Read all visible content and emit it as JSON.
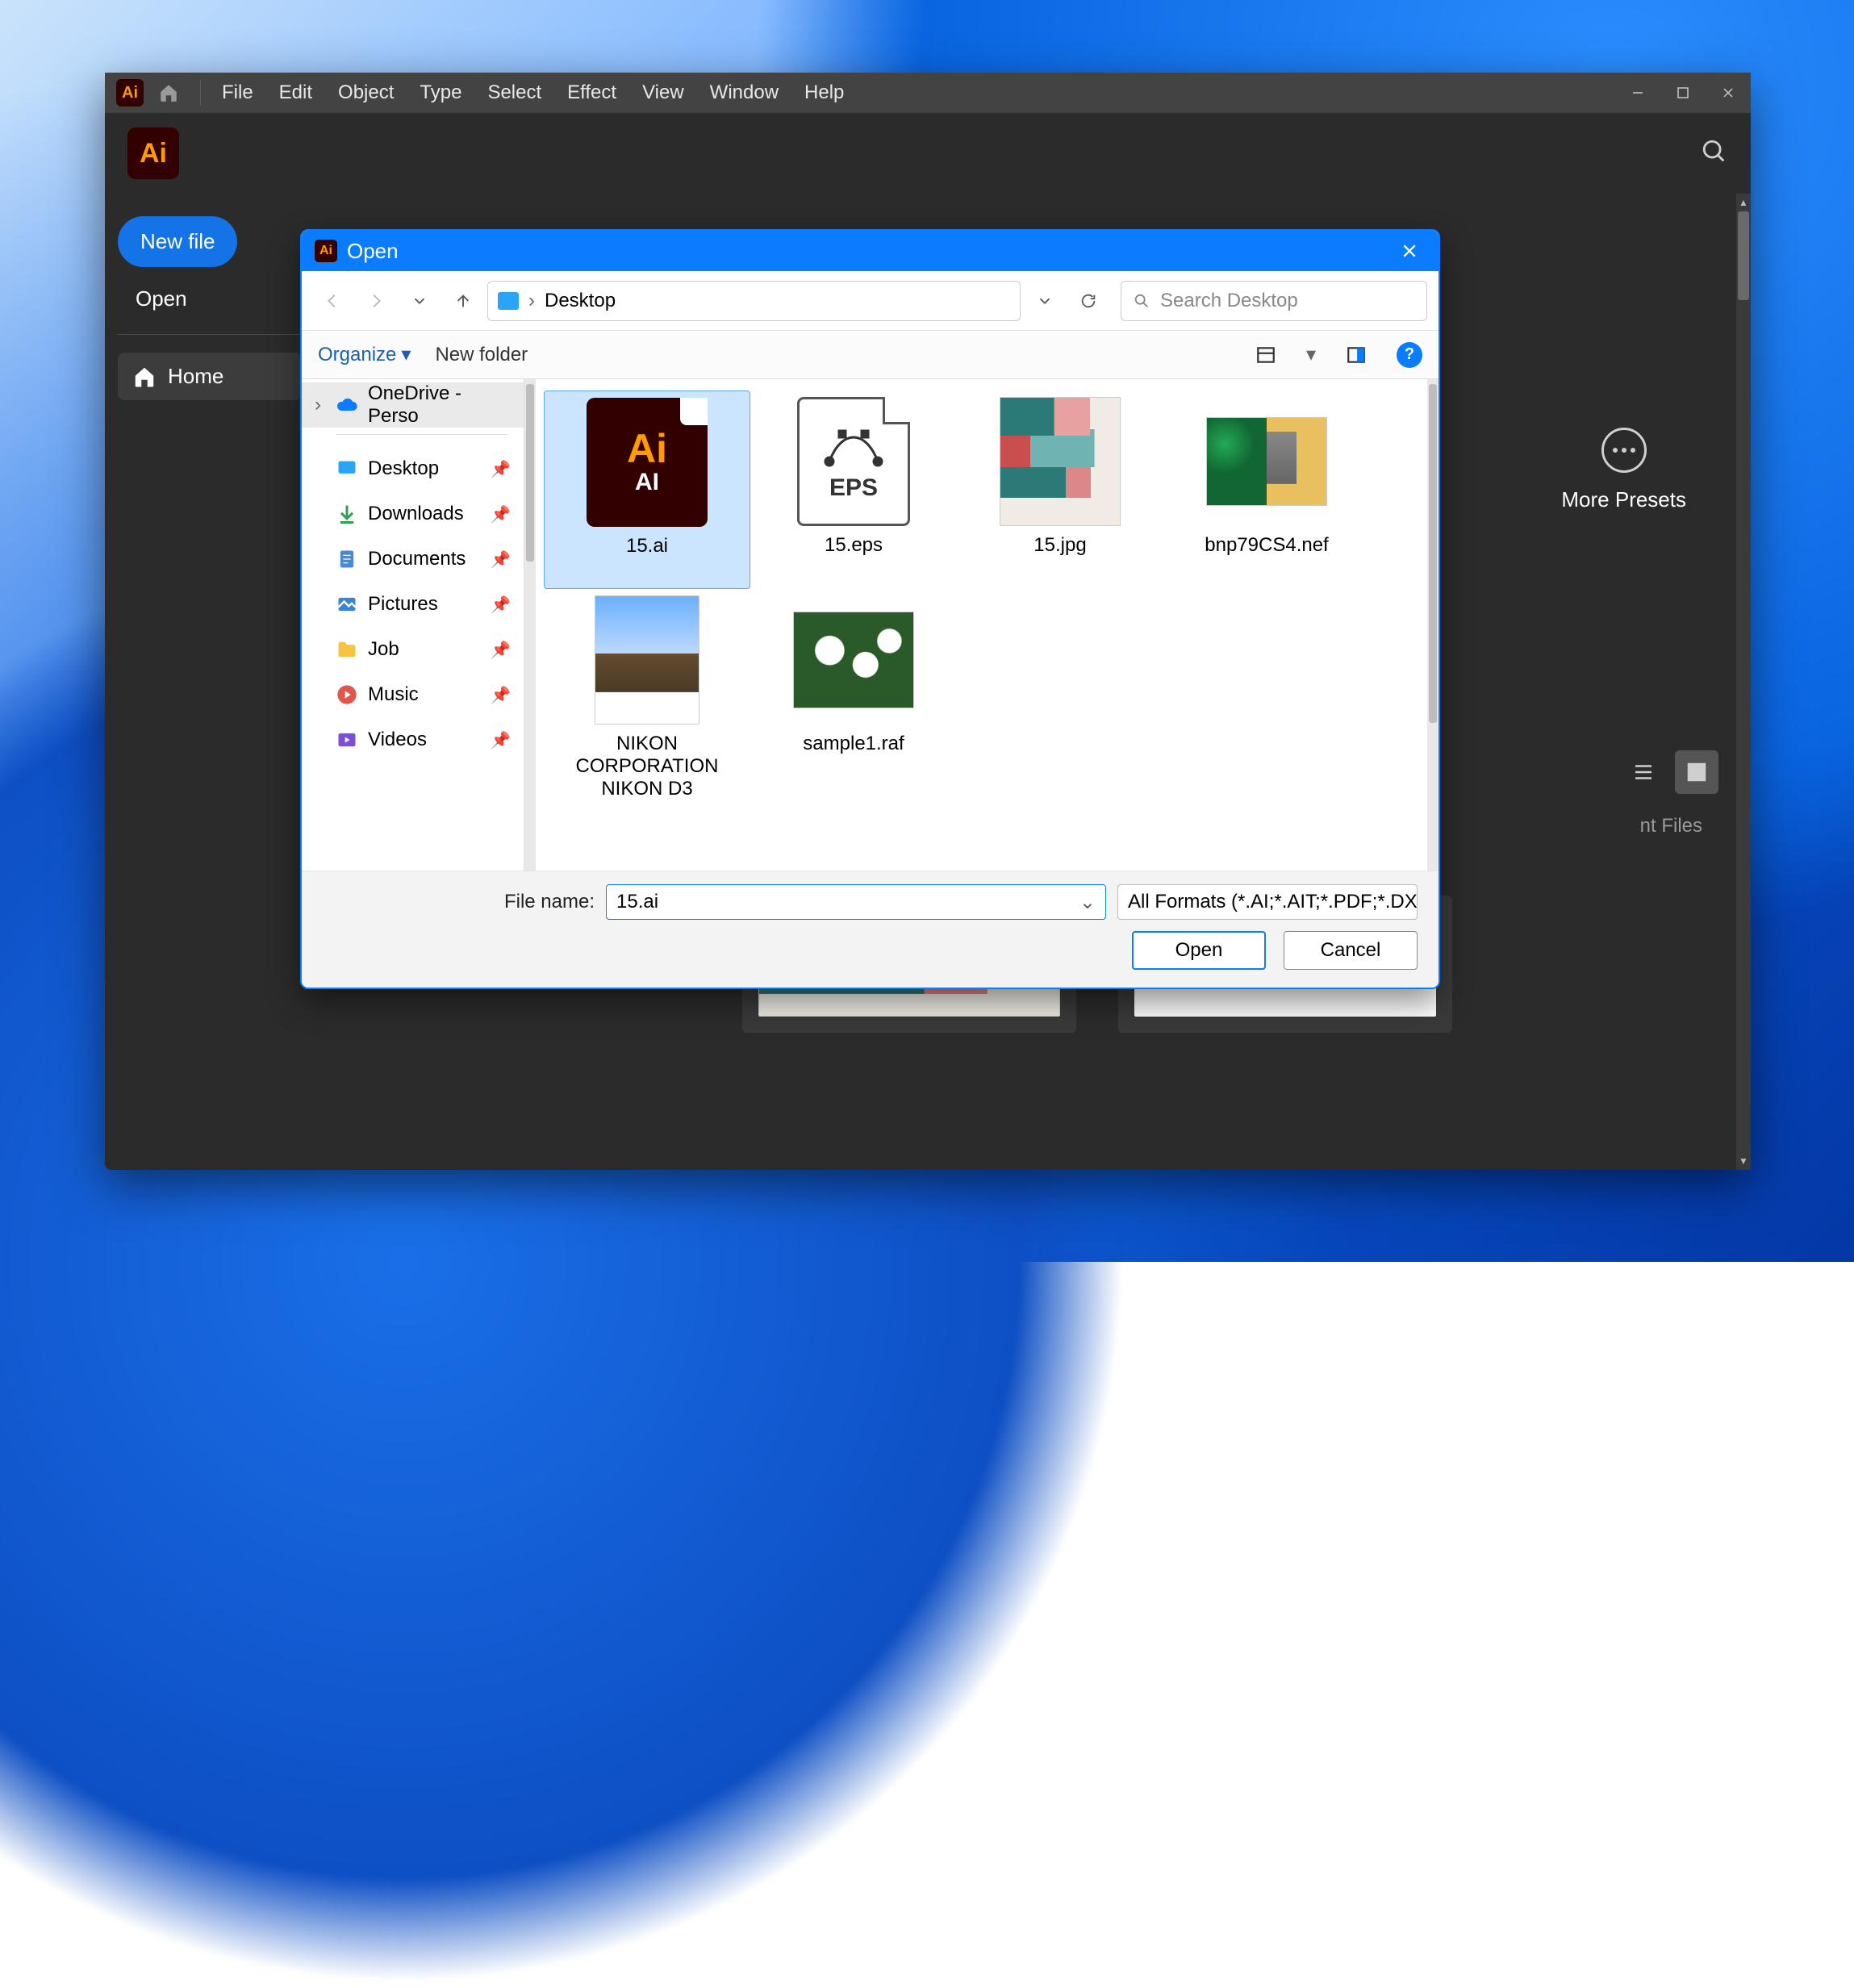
{
  "ai": {
    "logo_text": "Ai",
    "menu": [
      "File",
      "Edit",
      "Object",
      "Type",
      "Select",
      "Effect",
      "View",
      "Window",
      "Help"
    ],
    "sidebar": {
      "new_file": "New file",
      "open": "Open",
      "home": "Home"
    },
    "more_presets": "More Presets",
    "recent_files_label": "nt Files"
  },
  "dialog": {
    "title": "Open",
    "breadcrumb": "Desktop",
    "search_placeholder": "Search Desktop",
    "organize": "Organize",
    "new_folder": "New folder",
    "tree": {
      "onedrive": "OneDrive - Perso",
      "quick": [
        "Desktop",
        "Downloads",
        "Documents",
        "Pictures",
        "Job",
        "Music",
        "Videos"
      ]
    },
    "files": [
      {
        "name": "15.ai",
        "kind": "ai",
        "selected": true
      },
      {
        "name": "15.eps",
        "kind": "eps"
      },
      {
        "name": "15.jpg",
        "kind": "tags"
      },
      {
        "name": "bnp79CS4.nef",
        "kind": "cat"
      },
      {
        "name": "NIKON CORPORATION NIKON D3",
        "kind": "mtn"
      },
      {
        "name": "sample1.raf",
        "kind": "flower"
      }
    ],
    "footer": {
      "file_name_label": "File name:",
      "file_name_value": "15.ai",
      "filter": "All Formats (*.AI;*.AIT;*.PDF;*.DX",
      "open": "Open",
      "cancel": "Cancel"
    }
  }
}
